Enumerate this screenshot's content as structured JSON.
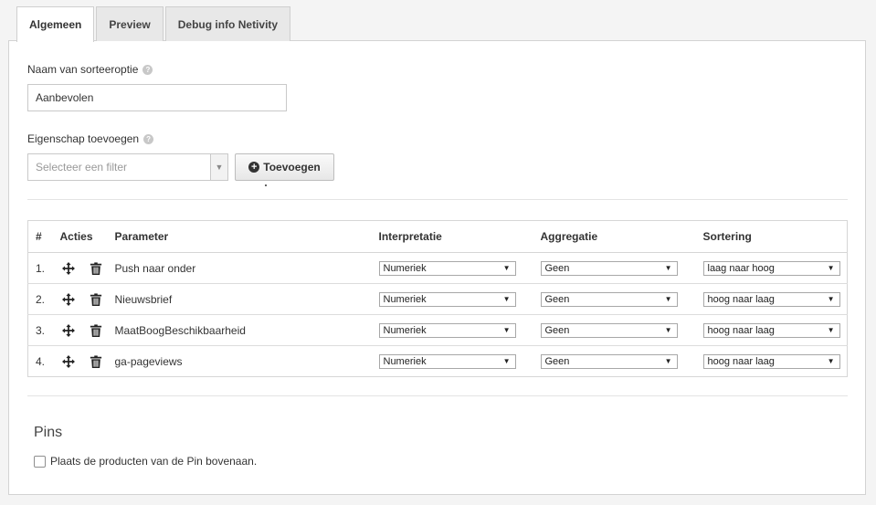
{
  "tabs": [
    {
      "label": "Algemeen",
      "active": true
    },
    {
      "label": "Preview",
      "active": false
    },
    {
      "label": "Debug info Netivity",
      "active": false
    }
  ],
  "form": {
    "name_label": "Naam van sorteeroptie",
    "name_value": "Aanbevolen",
    "property_label": "Eigenschap toevoegen",
    "filter_placeholder": "Selecteer een filter",
    "add_button": "Toevoegen"
  },
  "table": {
    "headers": [
      "#",
      "Acties",
      "Parameter",
      "Interpretatie",
      "Aggregatie",
      "Sortering"
    ],
    "rows": [
      {
        "num": "1.",
        "parameter": "Push naar onder",
        "interpretatie": "Numeriek",
        "aggregatie": "Geen",
        "sortering": "laag naar hoog"
      },
      {
        "num": "2.",
        "parameter": "Nieuwsbrief",
        "interpretatie": "Numeriek",
        "aggregatie": "Geen",
        "sortering": "hoog naar laag"
      },
      {
        "num": "3.",
        "parameter": "MaatBoogBeschikbaarheid",
        "interpretatie": "Numeriek",
        "aggregatie": "Geen",
        "sortering": "hoog naar laag"
      },
      {
        "num": "4.",
        "parameter": "ga-pageviews",
        "interpretatie": "Numeriek",
        "aggregatie": "Geen",
        "sortering": "hoog naar laag"
      }
    ]
  },
  "pins": {
    "title": "Pins",
    "checkbox_label": "Plaats de producten van de Pin bovenaan.",
    "checked": false
  },
  "icons": {
    "help": "help-circle-icon",
    "dropdown": "chevron-down-icon",
    "add": "plus-circle-icon",
    "move": "move-arrows-icon",
    "delete": "trash-icon"
  },
  "colors": {
    "background": "#f4f4f4",
    "panel": "#ffffff",
    "border": "#d3d3d3",
    "text": "#333333"
  }
}
